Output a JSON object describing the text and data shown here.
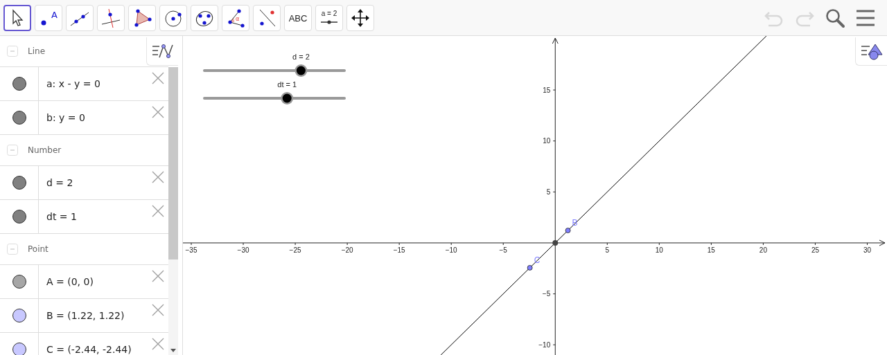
{
  "toolbar": {
    "tools": [
      {
        "kind": "move",
        "selected": true
      },
      {
        "kind": "point",
        "selected": false,
        "label": "A"
      },
      {
        "kind": "line",
        "selected": false
      },
      {
        "kind": "perpendicular",
        "selected": false
      },
      {
        "kind": "polygon",
        "selected": false
      },
      {
        "kind": "circle",
        "selected": false
      },
      {
        "kind": "conic",
        "selected": false
      },
      {
        "kind": "angle",
        "selected": false,
        "label": "α"
      },
      {
        "kind": "reflect",
        "selected": false
      },
      {
        "kind": "text",
        "selected": false,
        "label": "ABC"
      },
      {
        "kind": "slider",
        "selected": false,
        "label": "a = 2"
      },
      {
        "kind": "pan",
        "selected": false
      }
    ],
    "actions": [
      {
        "kind": "undo",
        "disabled": true
      },
      {
        "kind": "redo",
        "disabled": true
      },
      {
        "kind": "search",
        "disabled": false
      },
      {
        "kind": "menu",
        "disabled": false
      }
    ]
  },
  "algebra": {
    "groups": [
      {
        "title": "Line",
        "expanded": true,
        "items": [
          {
            "text": "a: x - y = 0",
            "color": "#808080"
          },
          {
            "text": "b: y = 0",
            "color": "#808080"
          }
        ]
      },
      {
        "title": "Number",
        "expanded": true,
        "items": [
          {
            "text": "d = 2",
            "color": "#808080"
          },
          {
            "text": "dt = 1",
            "color": "#808080"
          }
        ]
      },
      {
        "title": "Point",
        "expanded": true,
        "items": [
          {
            "text": "A = (0, 0)",
            "color": "#a6a6a6"
          },
          {
            "text": "B = (1.22, 1.22)",
            "color": "#c8c8ff"
          },
          {
            "text": "C = (-2.44, -2.44)",
            "color": "#c8c8ff"
          }
        ]
      }
    ]
  },
  "graphics": {
    "sliders": [
      {
        "label": "d = 2",
        "level": 0.69
      },
      {
        "label": "dt = 1",
        "level": 0.59
      }
    ],
    "chart_data": {
      "type": "line",
      "xticks": [
        {
          "value": -35,
          "label": "−35"
        },
        {
          "value": -30,
          "label": "−30"
        },
        {
          "value": -25,
          "label": "−25"
        },
        {
          "value": -20,
          "label": "−20"
        },
        {
          "value": -15,
          "label": "−15"
        },
        {
          "value": -10,
          "label": "−10"
        },
        {
          "value": -5,
          "label": "−5"
        },
        5,
        10,
        15,
        20,
        25,
        30
      ],
      "yticks": [
        {
          "value": -10,
          "label": "−10"
        },
        {
          "value": -5,
          "label": "−5"
        },
        5,
        10,
        15
      ],
      "xlim": [
        -35.8,
        31.9
      ],
      "ylim": [
        -11,
        20.3
      ],
      "series": [
        {
          "color": "#000000",
          "x": [
            -11,
            20.3
          ],
          "values": [
            -11,
            20.3
          ]
        },
        {
          "color": "#444444",
          "x": [
            0
          ],
          "values": [
            0
          ],
          "marker": "circle"
        }
      ],
      "annotations": [
        {
          "x": 1.22,
          "y": 1.22,
          "text": "B"
        },
        {
          "x": -2.44,
          "y": -2.44,
          "text": "C"
        }
      ]
    }
  }
}
